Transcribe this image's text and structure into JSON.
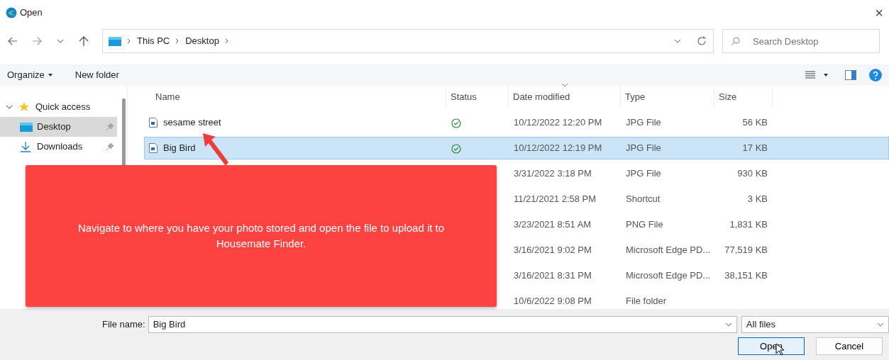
{
  "window": {
    "title": "Open",
    "close": "×"
  },
  "address": {
    "crumbs": [
      "This PC",
      "Desktop"
    ]
  },
  "search": {
    "placeholder": "Search Desktop"
  },
  "toolbar": {
    "organize": "Organize",
    "new_folder": "New folder"
  },
  "sidebar": {
    "items": [
      {
        "label": "Quick access",
        "kind": "group",
        "expanded": true,
        "selected": false
      },
      {
        "label": "Desktop",
        "kind": "desktop",
        "pinned": true,
        "selected": true
      },
      {
        "label": "Downloads",
        "kind": "downloads",
        "pinned": true,
        "selected": false
      }
    ]
  },
  "table": {
    "columns": [
      "Name",
      "Status",
      "Date modified",
      "Type",
      "Size"
    ],
    "rows": [
      {
        "name": "sesame street",
        "synced": true,
        "date": "10/12/2022 12:20 PM",
        "type": "JPG File",
        "size": "56 KB",
        "selected": false
      },
      {
        "name": "Big Bird",
        "synced": true,
        "date": "10/12/2022 12:19 PM",
        "type": "JPG File",
        "size": "17 KB",
        "selected": true
      },
      {
        "date": "3/31/2022 3:18 PM",
        "type": "JPG File",
        "size": "930 KB",
        "selected": false
      },
      {
        "date": "11/21/2021 2:58 PM",
        "type": "Shortcut",
        "size": "3 KB",
        "selected": false
      },
      {
        "date": "3/23/2021 8:51 AM",
        "type": "PNG File",
        "size": "1,831 KB",
        "selected": false
      },
      {
        "date": "3/16/2021 9:02 PM",
        "type": "Microsoft Edge PD...",
        "size": "77,519 KB",
        "selected": false
      },
      {
        "date": "3/16/2021 8:31 PM",
        "type": "Microsoft Edge PD...",
        "size": "38,151 KB",
        "selected": false
      },
      {
        "date": "10/6/2022 9:08 PM",
        "type": "File folder",
        "selected": false
      }
    ]
  },
  "footer": {
    "file_name_label": "File name:",
    "file_name": "Big Bird",
    "filter": "All files",
    "open": "Open",
    "cancel": "Cancel"
  },
  "callout": {
    "text": "Navigate to where you have your photo stored and open the file to upload it to Housemate Finder."
  }
}
